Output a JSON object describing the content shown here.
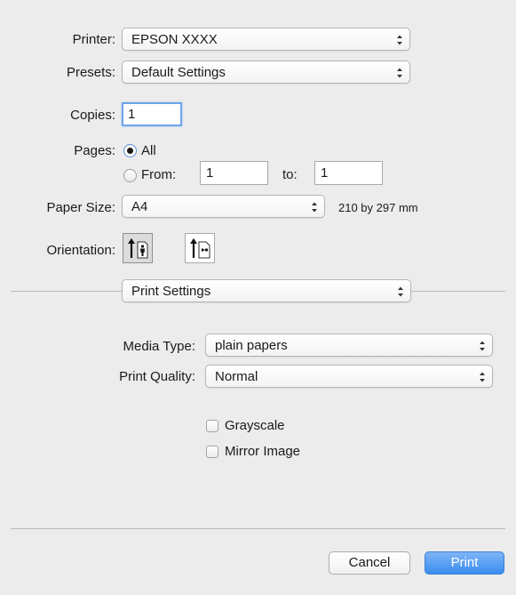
{
  "printer": {
    "label": "Printer:",
    "value": "EPSON XXXX"
  },
  "presets": {
    "label": "Presets:",
    "value": "Default Settings"
  },
  "copies": {
    "label": "Copies:",
    "value": "1"
  },
  "pages": {
    "label": "Pages:",
    "all_label": "All",
    "from_label": "From:",
    "from_value": "1",
    "to_label": "to:",
    "to_value": "1",
    "selected": "All"
  },
  "paper_size": {
    "label": "Paper Size:",
    "value": "A4",
    "dimensions": "210 by 297 mm"
  },
  "orientation": {
    "label": "Orientation:",
    "options": [
      "portrait-icon",
      "landscape-icon"
    ],
    "selected": "portrait"
  },
  "section_popup": {
    "value": "Print Settings"
  },
  "media_type": {
    "label": "Media Type:",
    "value": "plain papers"
  },
  "print_quality": {
    "label": "Print Quality:",
    "value": "Normal"
  },
  "grayscale": {
    "label": "Grayscale",
    "checked": false
  },
  "mirror_image": {
    "label": "Mirror Image",
    "checked": false
  },
  "buttons": {
    "cancel": "Cancel",
    "print": "Print"
  },
  "colors": {
    "accent": "#3a8ef0",
    "background": "#ececec"
  }
}
